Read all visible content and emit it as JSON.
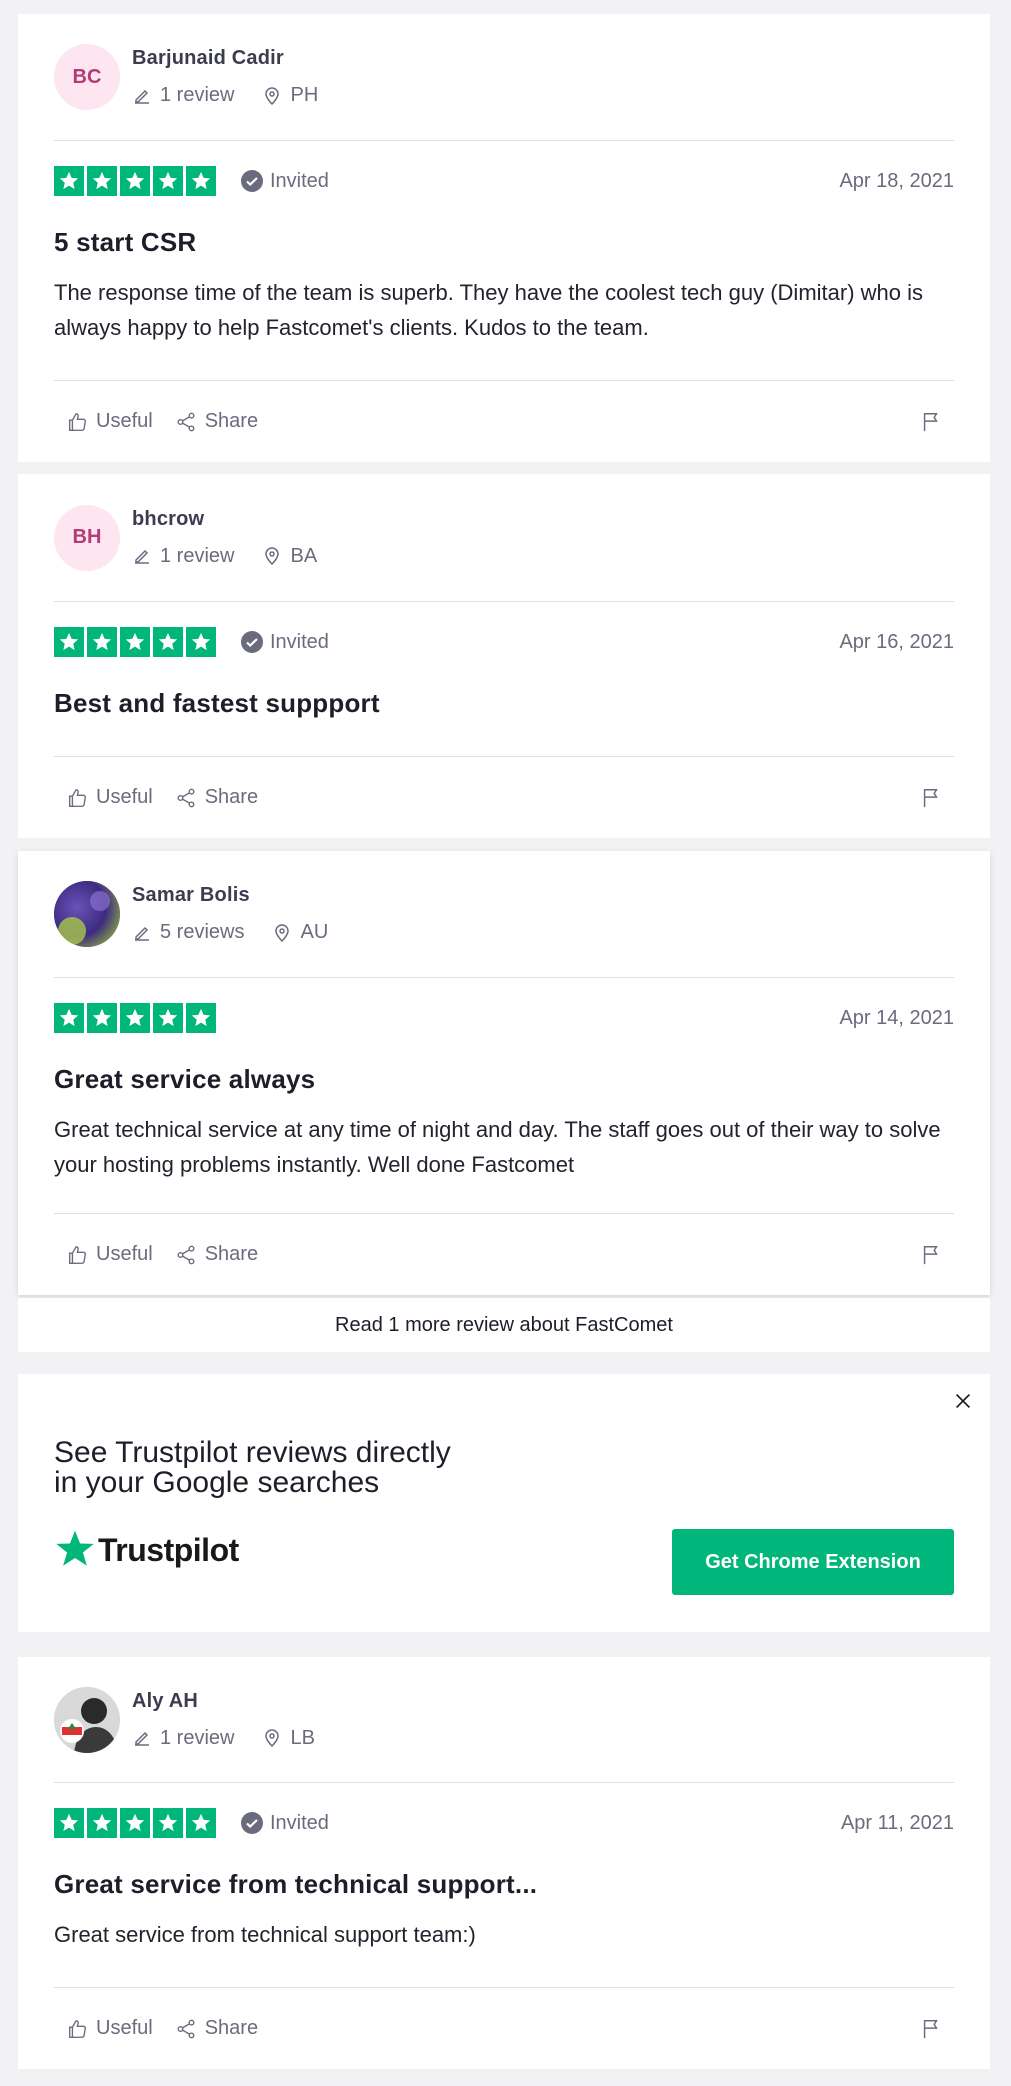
{
  "reviews": [
    {
      "initials": "BC",
      "name": "Barjunaid Cadir",
      "review_count": "1 review",
      "country": "PH",
      "rating": 5,
      "invited": "Invited",
      "date": "Apr 18, 2021",
      "title": "5 start CSR",
      "body": "The response time of the team is superb. They have the coolest tech guy (Dimitar) who is always happy to help Fastcomet's clients. Kudos to the team.",
      "useful": "Useful",
      "share": "Share"
    },
    {
      "initials": "BH",
      "name": "bhcrow",
      "review_count": "1 review",
      "country": "BA",
      "rating": 5,
      "invited": "Invited",
      "date": "Apr 16, 2021",
      "title": "Best and fastest suppport",
      "body": "",
      "useful": "Useful",
      "share": "Share"
    },
    {
      "initials": "",
      "name": "Samar Bolis",
      "review_count": "5 reviews",
      "country": "AU",
      "rating": 5,
      "invited": "",
      "date": "Apr 14, 2021",
      "title": "Great service always",
      "body": "Great technical service at any time of night and day. The staff goes out of their way to solve your hosting problems instantly. Well done Fastcomet",
      "useful": "Useful",
      "share": "Share"
    },
    {
      "initials": "",
      "name": "Aly AH",
      "review_count": "1 review",
      "country": "LB",
      "rating": 5,
      "invited": "Invited",
      "date": "Apr 11, 2021",
      "title": "Great service from technical support...",
      "body": "Great service from technical support team:)",
      "useful": "Useful",
      "share": "Share"
    }
  ],
  "more_reviews_link": "Read 1 more review about FastComet",
  "promo": {
    "title_line1": "See Trustpilot reviews directly",
    "title_line2": "in your Google searches",
    "logo_text": "Trustpilot",
    "button_label": "Get Chrome Extension"
  },
  "colors": {
    "accent": "#00b67a",
    "text_muted": "#6b6b7e",
    "background": "#f2f2f4"
  }
}
